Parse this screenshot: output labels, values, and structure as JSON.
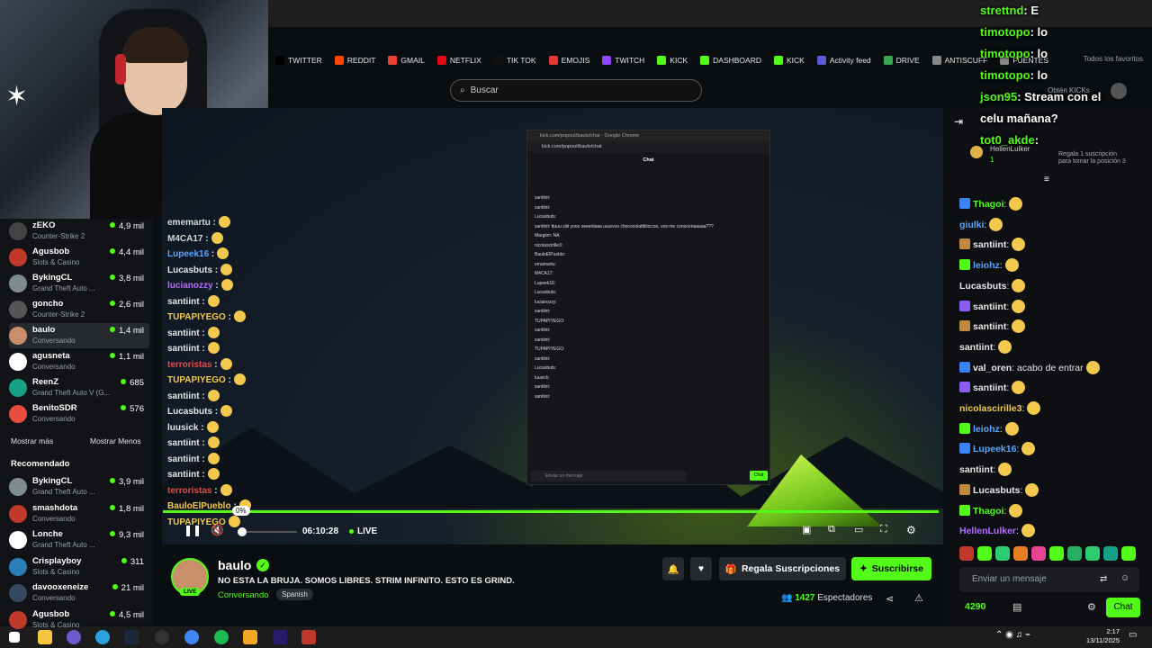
{
  "bookmarks": [
    "TWITTER",
    "REDDIT",
    "GMAIL",
    "NETFLIX",
    "TIK TOK",
    "EMOJIS",
    "TWITCH",
    "KICK",
    "DASHBOARD",
    "KICK",
    "Activity feed",
    "DRIVE",
    "ANTISCUFF",
    "FUENTES"
  ],
  "favorites_label": "Todos los favoritos",
  "search": {
    "placeholder": "Buscar"
  },
  "sidebar": {
    "channels": [
      {
        "name": "zEKO",
        "game": "Counter-Strike 2",
        "viewers": "4,9 mil"
      },
      {
        "name": "Agusbob",
        "game": "Slots & Casino",
        "viewers": "4,4 mil"
      },
      {
        "name": "BykingCL",
        "game": "Grand Theft Auto ...",
        "viewers": "3,8 mil"
      },
      {
        "name": "goncho",
        "game": "Counter-Strike 2",
        "viewers": "2,6 mil"
      },
      {
        "name": "baulo",
        "game": "Conversando",
        "viewers": "1,4 mil"
      },
      {
        "name": "agusneta",
        "game": "Conversando",
        "viewers": "1,1 mil"
      },
      {
        "name": "ReenZ",
        "game": "Grand Theft Auto V (G...",
        "viewers": "685"
      },
      {
        "name": "BenitoSDR",
        "game": "Conversando",
        "viewers": "576"
      }
    ],
    "show_more": "Mostrar más",
    "show_less": "Mostrar Menos",
    "recommended_title": "Recomendado",
    "recommended": [
      {
        "name": "BykingCL",
        "game": "Grand Theft Auto ...",
        "viewers": "3,9 mil"
      },
      {
        "name": "smashdota",
        "game": "Conversando",
        "viewers": "1,8 mil"
      },
      {
        "name": "Lonche",
        "game": "Grand Theft Auto ...",
        "viewers": "9,3 mil"
      },
      {
        "name": "Crisplayboy",
        "game": "Slots & Casino",
        "viewers": "311"
      },
      {
        "name": "davooxeneize",
        "game": "Conversando",
        "viewers": "21 mil"
      },
      {
        "name": "Agusbob",
        "game": "Slots & Casino",
        "viewers": "4,5 mil"
      }
    ]
  },
  "inner_window": {
    "title": "kick.com/popout/baulo/chat - Google Chrome",
    "url": "kick.com/popout/baulo/chat",
    "chat_title": "Chat",
    "lines": [
      "santiint:",
      "santiint:",
      "Lucasbuts:",
      "santiint: ttuuu siiii yooo seeeriiaaa uuurvvo chocooolatttiiiiccoo, vos me conoceriaaaaa???",
      "Margiim: NA",
      "nicolascirille3:",
      "BauloElPueblo:",
      "emamartu:",
      "M4CA17:",
      "Lupeek16:",
      "Lucasbuts:",
      "lucianozzy:",
      "santiint:",
      "TUPAPIYEGO:",
      "santiint:",
      "santiint:",
      "TUPAPIYEGO:",
      "santiint:",
      "Lucasbuts:",
      "luusick:",
      "santiint:",
      "santiint:"
    ],
    "input_placeholder": "Enviar un mensaje",
    "chat_button": "Chat"
  },
  "overlay_chat": [
    {
      "user": "ememartu",
      "color": "#d7d7d7",
      "text": " :"
    },
    {
      "user": "M4CA17",
      "color": "#d7d7d7",
      "text": " :"
    },
    {
      "user": "Lupeek16",
      "color": "#5aa5ff",
      "text": " :"
    },
    {
      "user": "Lucasbuts",
      "color": "#e5e5e5",
      "text": " :"
    },
    {
      "user": "lucianozzy",
      "color": "#b46cff",
      "text": " :"
    },
    {
      "user": "santiint",
      "color": "#e5e5e5",
      "text": " :"
    },
    {
      "user": "TUPAPIYEGO",
      "color": "#f2c94c",
      "text": " :"
    },
    {
      "user": "santiint",
      "color": "#e5e5e5",
      "text": " :"
    },
    {
      "user": "santiint",
      "color": "#e5e5e5",
      "text": " :"
    },
    {
      "user": "terroristas",
      "color": "#e04b4b",
      "text": " :"
    },
    {
      "user": "TUPAPIYEGO",
      "color": "#f2c94c",
      "text": " :"
    },
    {
      "user": "santiint",
      "color": "#e5e5e5",
      "text": " :"
    },
    {
      "user": "Lucasbuts",
      "color": "#e5e5e5",
      "text": " :"
    },
    {
      "user": "luusick",
      "color": "#e5e5e5",
      "text": " :"
    },
    {
      "user": "santiint",
      "color": "#e5e5e5",
      "text": " :"
    },
    {
      "user": "santiint",
      "color": "#e5e5e5",
      "text": " :"
    },
    {
      "user": "santiint",
      "color": "#e5e5e5",
      "text": " :"
    },
    {
      "user": "terroristas",
      "color": "#e04b4b",
      "text": " :"
    },
    {
      "user": "BauloElPueblo",
      "color": "#f2c94c",
      "text": " :"
    },
    {
      "user": "TUPAPIYEGO",
      "color": "#f2c94c",
      "text": ""
    }
  ],
  "player": {
    "volume_tooltip": "0%",
    "time": "06:10:28",
    "live_label": "LIVE",
    "accent": "#53fc18"
  },
  "stream": {
    "name": "baulo",
    "title": "NO ESTA LA BRUJA. SOMOS LIBRES. STRIM INFINITO. ESTO ES GRIND.",
    "category": "Conversando",
    "language": "Spanish",
    "live_badge": "LIVE",
    "gift_button": "Regala Suscripciones",
    "subscribe_button": "Suscribirse",
    "viewers_count": "1427",
    "viewers_label": "Espectadores"
  },
  "overlay_top": [
    {
      "user": "strettnd",
      "text": "E"
    },
    {
      "user": "timotopo",
      "text": "lo"
    },
    {
      "user": "timotopo",
      "text": "lo"
    },
    {
      "user": "timotopo",
      "text": "lo"
    },
    {
      "user": "json95",
      "text": "Stream con el"
    },
    {
      "user": "",
      "text": "celu mañana?"
    },
    {
      "user": "tot0_akde",
      "text": ""
    }
  ],
  "pinned": {
    "user": "HellenLulker",
    "count": "1",
    "text": "Regala 1 suscripción para tomar la posición 3",
    "obten": "Obtén KICKs"
  },
  "chat": [
    {
      "user": "Thagoi",
      "color": "#53fc18",
      "text": ":"
    },
    {
      "user": "giulki",
      "color": "#5aa5ff",
      "text": ":"
    },
    {
      "user": "santiint",
      "color": "#e5e5e5",
      "text": ":"
    },
    {
      "user": "leiohz",
      "color": "#5aa5ff",
      "text": ":"
    },
    {
      "user": "Lucasbuts",
      "color": "#e5e5e5",
      "text": ":"
    },
    {
      "user": "santiint",
      "color": "#e5e5e5",
      "text": ":"
    },
    {
      "user": "santiint",
      "color": "#e5e5e5",
      "text": ":"
    },
    {
      "user": "santiint",
      "color": "#e5e5e5",
      "text": ":"
    },
    {
      "user": "val_oren",
      "color": "#e5e5e5",
      "text": ": acabo de entrar"
    },
    {
      "user": "santiint",
      "color": "#e5e5e5",
      "text": ":"
    },
    {
      "user": "nicolascirille3",
      "color": "#f2c94c",
      "text": ":"
    },
    {
      "user": "leiohz",
      "color": "#5aa5ff",
      "text": ":"
    },
    {
      "user": "Lupeek16",
      "color": "#5aa5ff",
      "text": ":"
    },
    {
      "user": "santiint",
      "color": "#e5e5e5",
      "text": ":"
    },
    {
      "user": "Lucasbuts",
      "color": "#e5e5e5",
      "text": ":"
    },
    {
      "user": "Thagoi",
      "color": "#53fc18",
      "text": ":"
    },
    {
      "user": "HellenLulker",
      "color": "#b46cff",
      "text": ":"
    }
  ],
  "chat_input": {
    "placeholder": "Enviar un mensaje"
  },
  "chat_points": "4290",
  "chat_button": "Chat",
  "clock": {
    "time": "2:17",
    "date": "13/11/2025"
  }
}
